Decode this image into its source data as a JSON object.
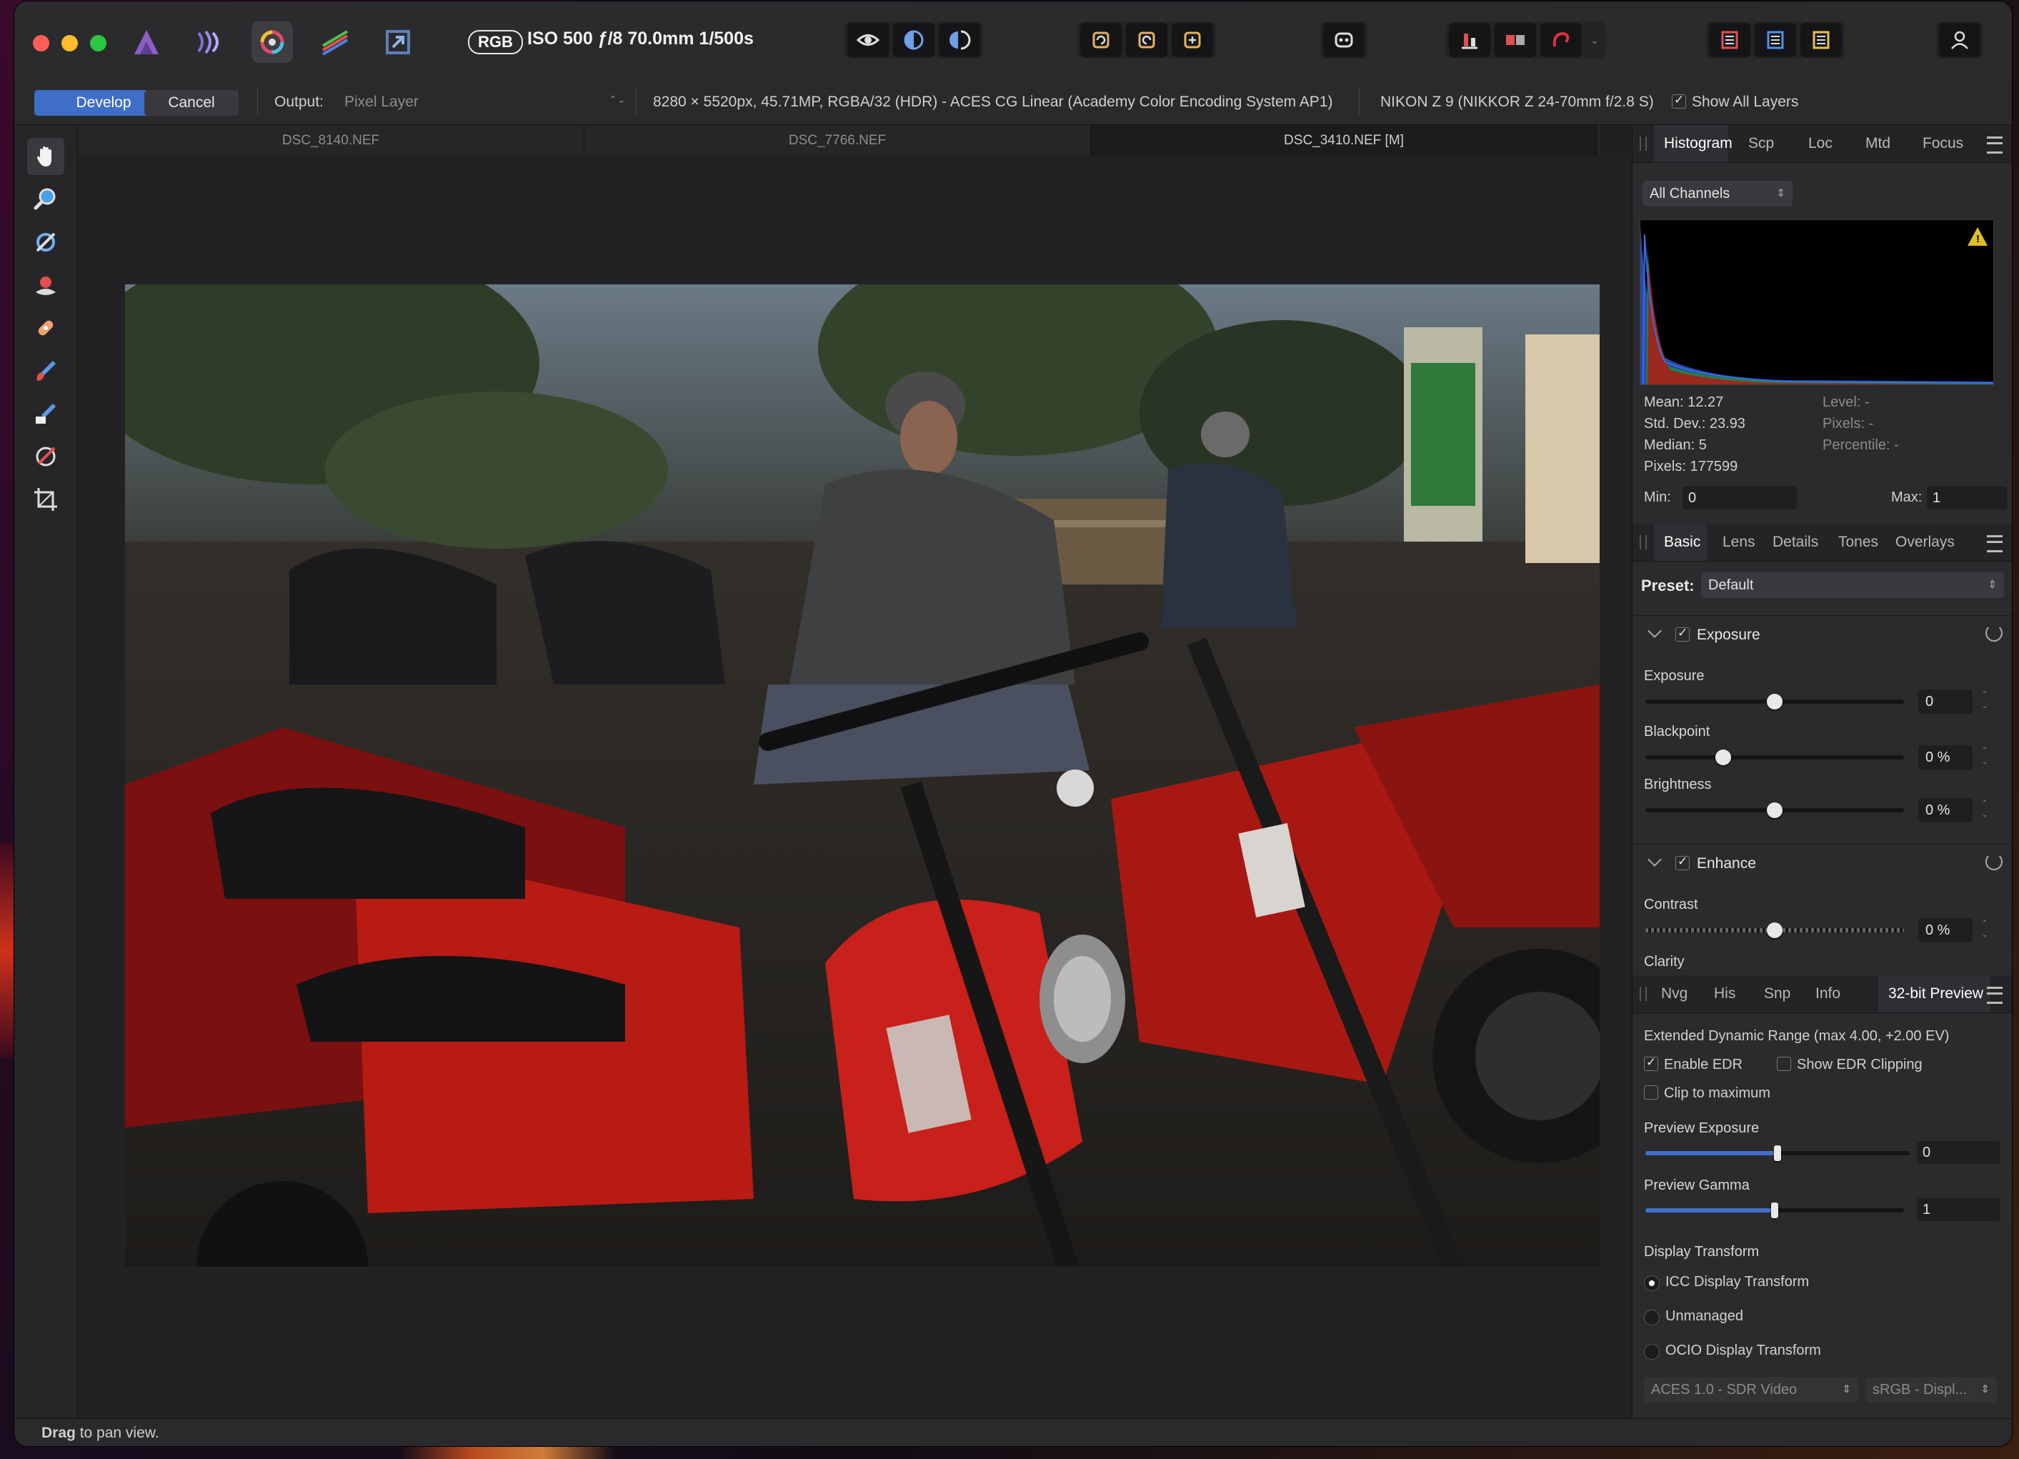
{
  "titlebar": {
    "color_mode_badge": "RGB",
    "exif": "ISO 500 ƒ/8 70.0mm 1/500s"
  },
  "context_toolbar": {
    "develop_label": "Develop",
    "cancel_label": "Cancel",
    "output_label": "Output:",
    "output_value": "Pixel Layer",
    "image_info": "8280 × 5520px, 45.71MP, RGBA/32 (HDR) - ACES CG Linear (Academy Color Encoding System AP1)",
    "camera_info": "NIKON Z 9 (NIKKOR Z 24-70mm f/2.8 S)",
    "show_all_layers_label": "Show All Layers",
    "show_all_layers_checked": true
  },
  "document_tabs": [
    {
      "label": "DSC_8140.NEF",
      "active": false
    },
    {
      "label": "DSC_7766.NEF",
      "active": false
    },
    {
      "label": "DSC_3410.NEF [M]",
      "active": true
    }
  ],
  "histogram_panel": {
    "tabs": [
      "Histogram",
      "Scp",
      "Loc",
      "Mtd",
      "Focus"
    ],
    "active_tab": "Histogram",
    "channel_select": "All Channels",
    "stats": {
      "mean": "Mean: 12.27",
      "std_dev": "Std. Dev.: 23.93",
      "median": "Median: 5",
      "pixels": "Pixels: 177599",
      "level": "Level: -",
      "pixels_right": "Pixels: -",
      "percentile": "Percentile: -"
    },
    "min_label": "Min:",
    "min_value": "0",
    "max_label": "Max:",
    "max_value": "1"
  },
  "basic_panel": {
    "tabs": [
      "Basic",
      "Lens",
      "Details",
      "Tones",
      "Overlays"
    ],
    "active_tab": "Basic",
    "preset_label": "Preset:",
    "preset_value": "Default",
    "exposure_section": {
      "title": "Exposure",
      "enabled": true,
      "sliders": [
        {
          "label": "Exposure",
          "value": "0",
          "position": 0.5
        },
        {
          "label": "Blackpoint",
          "value": "0 %",
          "position": 0.3
        },
        {
          "label": "Brightness",
          "value": "0 %",
          "position": 0.5
        }
      ]
    },
    "enhance_section": {
      "title": "Enhance",
      "enabled": true,
      "sliders": [
        {
          "label": "Contrast",
          "value": "0 %",
          "position": 0.5
        }
      ],
      "next_label": "Clarity"
    }
  },
  "preview_panel": {
    "tabs": [
      "Nvg",
      "His",
      "Snp",
      "Info",
      "32-bit Preview"
    ],
    "active_tab": "32-bit Preview",
    "edr_title": "Extended Dynamic Range (max 4.00, +2.00 EV)",
    "enable_edr_label": "Enable EDR",
    "enable_edr_checked": true,
    "show_edr_clipping_label": "Show EDR Clipping",
    "show_edr_clipping_checked": false,
    "clip_to_max_label": "Clip to maximum",
    "clip_to_max_checked": false,
    "preview_exposure_label": "Preview Exposure",
    "preview_exposure_value": "0",
    "preview_exposure_position": 0.5,
    "preview_gamma_label": "Preview Gamma",
    "preview_gamma_value": "1",
    "preview_gamma_position": 0.5,
    "display_transform_label": "Display Transform",
    "transforms": [
      {
        "label": "ICC Display Transform",
        "selected": true
      },
      {
        "label": "Unmanaged",
        "selected": false
      },
      {
        "label": "OCIO Display Transform",
        "selected": false
      }
    ],
    "ocio_view": "ACES 1.0 - SDR Video",
    "ocio_display": "sRGB - Displ..."
  },
  "statusbar": {
    "bold": "Drag",
    "text": " to pan view."
  },
  "colors": {
    "accent": "#3f6ec8",
    "warning": "#e0c020"
  }
}
